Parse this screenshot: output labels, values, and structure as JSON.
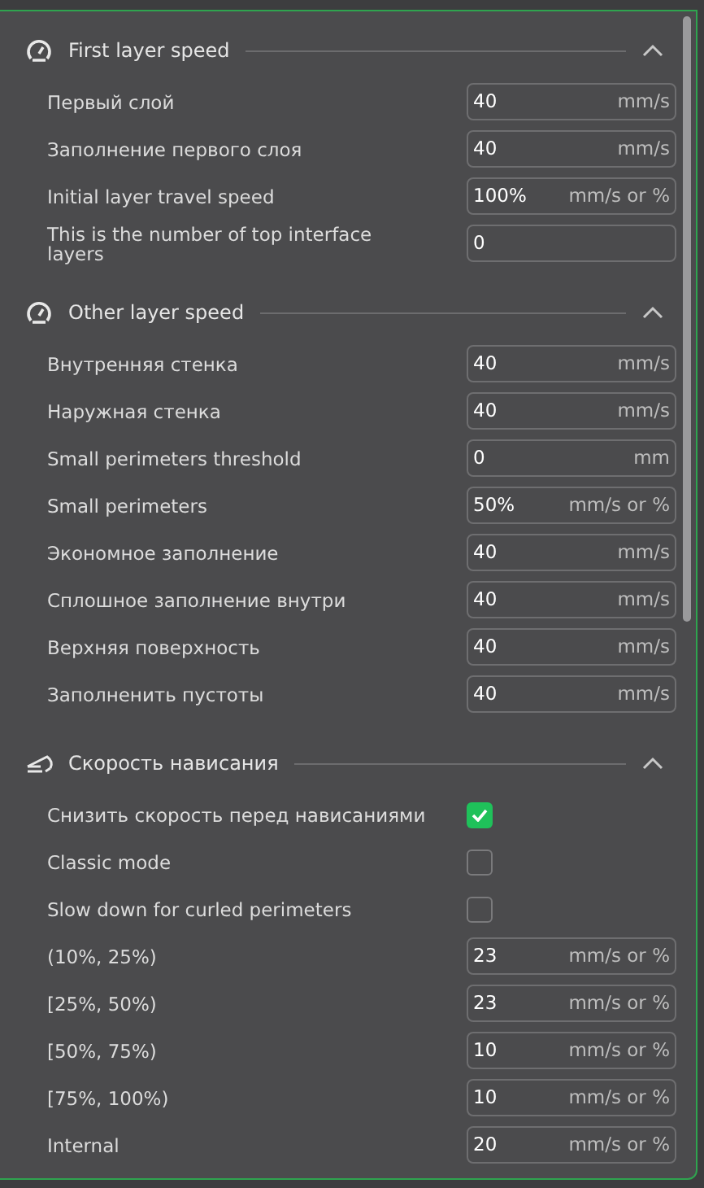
{
  "sections": [
    {
      "title": "First layer speed",
      "kind": "gauge",
      "expanded": true,
      "rows": [
        {
          "kind": "field",
          "label": "Первый слой",
          "value": "40",
          "unit": "mm/s"
        },
        {
          "kind": "field",
          "label": "Заполнение первого слоя",
          "value": "40",
          "unit": "mm/s"
        },
        {
          "kind": "field",
          "label": "Initial layer travel speed",
          "value": "100%",
          "unit": "mm/s or %"
        },
        {
          "kind": "field",
          "label": "This is the number of top interface layers",
          "value": "0"
        }
      ]
    },
    {
      "title": "Other layer speed",
      "kind": "gauge",
      "expanded": true,
      "rows": [
        {
          "kind": "field",
          "label": "Внутренняя стенка",
          "value": "40",
          "unit": "mm/s"
        },
        {
          "kind": "field",
          "label": "Наружная стенка",
          "value": "40",
          "unit": "mm/s"
        },
        {
          "kind": "field",
          "label": "Small perimeters threshold",
          "value": "0",
          "unit": "mm"
        },
        {
          "kind": "field",
          "label": "Small perimeters",
          "value": "50%",
          "unit": "mm/s or %"
        },
        {
          "kind": "field",
          "label": "Экономное заполнение",
          "value": "40",
          "unit": "mm/s"
        },
        {
          "kind": "field",
          "label": "Сплошное заполнение внутри",
          "value": "40",
          "unit": "mm/s"
        },
        {
          "kind": "field",
          "label": "Верхняя поверхность",
          "value": "40",
          "unit": "mm/s"
        },
        {
          "kind": "field",
          "label": "Заполненить пустоты",
          "value": "40",
          "unit": "mm/s"
        }
      ]
    },
    {
      "title": "Скорость нависания",
      "kind": "overhang",
      "expanded": true,
      "rows": [
        {
          "kind": "checkbox",
          "label": "Снизить скорость перед нависаниями",
          "checked": true
        },
        {
          "kind": "checkbox",
          "label": "Classic mode",
          "checked": false
        },
        {
          "kind": "checkbox",
          "label": "Slow down for curled perimeters",
          "checked": false
        },
        {
          "kind": "field",
          "label": "(10%, 25%)",
          "value": "23",
          "unit": "mm/s or %"
        },
        {
          "kind": "field",
          "label": "[25%, 50%)",
          "value": "23",
          "unit": "mm/s or %"
        },
        {
          "kind": "field",
          "label": "[50%, 75%)",
          "value": "10",
          "unit": "mm/s or %"
        },
        {
          "kind": "field",
          "label": "[75%, 100%)",
          "value": "10",
          "unit": "mm/s or %"
        },
        {
          "kind": "field",
          "label": "Internal",
          "value": "20",
          "unit": "mm/s or %"
        }
      ]
    }
  ]
}
